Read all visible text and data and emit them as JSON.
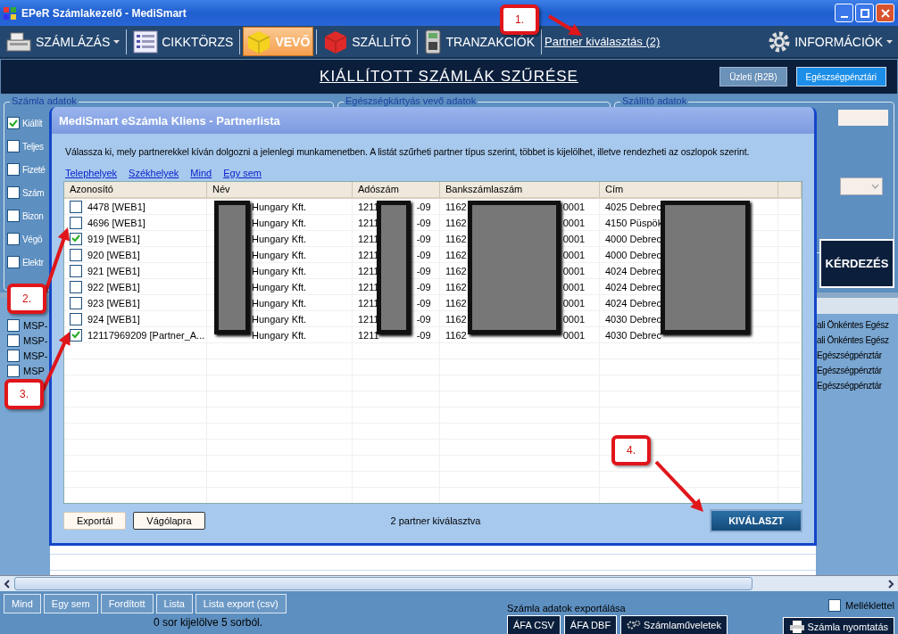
{
  "window": {
    "title": "EPeR Számlakezelő - MediSmart"
  },
  "toolbar": {
    "items": [
      {
        "label": "SZÁMLÁZÁS",
        "kind": "register",
        "dropdown": true,
        "selected": false
      },
      {
        "label": "CIKKTÖRZS",
        "kind": "list",
        "dropdown": false,
        "selected": false
      },
      {
        "label": "VEVŐ",
        "kind": "cube",
        "color": "#f5d21e",
        "dropdown": false,
        "selected": true
      },
      {
        "label": "SZÁLLÍTÓ",
        "kind": "cube",
        "color": "#e02a2a",
        "dropdown": false,
        "selected": false
      },
      {
        "label": "TRANZAKCIÓK",
        "kind": "terminal",
        "dropdown": false,
        "selected": false
      }
    ],
    "partner_link": "Partner kiválasztás (2)",
    "info": {
      "label": "INFORMÁCIÓK",
      "dropdown": true
    }
  },
  "filter_header": {
    "title": "KIÁLLÍTOTT SZÁMLÁK SZŰRÉSE",
    "modes": [
      {
        "label": "Üzleti (B2B)",
        "selected": false
      },
      {
        "label": "Egészségpénztári",
        "selected": true
      }
    ]
  },
  "filters": {
    "groups": [
      "Számla adatok",
      "Egészségkártyás vevő adatok",
      "Szállító adatok"
    ],
    "invoice_options": [
      {
        "label": "Kiállít",
        "checked": true
      },
      {
        "label": "Teljes",
        "checked": false
      },
      {
        "label": "Fizeté",
        "checked": false
      },
      {
        "label": "Szám",
        "checked": false
      },
      {
        "label": "Bizon",
        "checked": false
      },
      {
        "label": "Végö",
        "checked": false
      },
      {
        "label": "Elektr",
        "checked": false
      }
    ],
    "query_button": "KÉRDEZÉS"
  },
  "results": {
    "left_rows": [
      {
        "label": "MSP-",
        "checked": false
      },
      {
        "label": "MSP-",
        "checked": false
      },
      {
        "label": "MSP-",
        "checked": false
      },
      {
        "label": "MSP",
        "checked": false
      }
    ],
    "right_cells": [
      "ali Önkéntes Egész",
      "ali Önkéntes Egész",
      "Egészségpénztár",
      "Egészségpénztár",
      "Egészségpénztár"
    ]
  },
  "bottom": {
    "selection_buttons": [
      "Mind",
      "Egy sem",
      "Fordított",
      "Lista",
      "Lista export (csv)"
    ],
    "status": "0 sor kijelölve 5 sorból.",
    "export_label": "Számla adatok exportálása",
    "export_buttons": [
      "ÁFA CSV",
      "ÁFA DBF",
      "Számlaműveletek"
    ],
    "attachment": {
      "label": "Melléklettel",
      "checked": false
    },
    "print_button": "Számla nyomtatás"
  },
  "dialog": {
    "title": "MediSmart eSzámla Kliens - Partnerlista",
    "description": "Válassza ki, mely partnerekkel kíván dolgozni a jelenlegi munkamenetben. A listát szűrheti partner típus szerint, többet is kijelölhet, illetve rendezheti az oszlopok szerint.",
    "filter_links": [
      "Telephelyek",
      "Székhelyek",
      "Mind",
      "Egy sem"
    ],
    "columns": [
      "Azonosító",
      "Név",
      "Adószám",
      "Bankszámlaszám",
      "Cím"
    ],
    "rows": [
      {
        "id": "4478 [WEB1]",
        "checked": false,
        "name": "Hungary Kft.",
        "tax_start": "1211",
        "tax_end": "-09",
        "bank_start": "1162",
        "bank_end": "0001",
        "address": "4025 Debrec"
      },
      {
        "id": "4696 [WEB1]",
        "checked": false,
        "name": "Hungary Kft.",
        "tax_start": "1211",
        "tax_end": "-09",
        "bank_start": "1162",
        "bank_end": "0001",
        "address": "4150 Püspök"
      },
      {
        "id": "919 [WEB1]",
        "checked": true,
        "name": "Hungary Kft.",
        "tax_start": "1211",
        "tax_end": "-09",
        "bank_start": "1162",
        "bank_end": "0001",
        "address": "4000 Debrec"
      },
      {
        "id": "920 [WEB1]",
        "checked": false,
        "name": "Hungary Kft.",
        "tax_start": "1211",
        "tax_end": "-09",
        "bank_start": "1162",
        "bank_end": "0001",
        "address": "4000 Debrec"
      },
      {
        "id": "921 [WEB1]",
        "checked": false,
        "name": "Hungary Kft.",
        "tax_start": "1211",
        "tax_end": "-09",
        "bank_start": "1162",
        "bank_end": "0001",
        "address": "4024 Debrec"
      },
      {
        "id": "922 [WEB1]",
        "checked": false,
        "name": "Hungary Kft.",
        "tax_start": "1211",
        "tax_end": "-09",
        "bank_start": "1162",
        "bank_end": "0001",
        "address": "4024 Debrec"
      },
      {
        "id": "923 [WEB1]",
        "checked": false,
        "name": "Hungary Kft.",
        "tax_start": "1211",
        "tax_end": "-09",
        "bank_start": "1162",
        "bank_end": "0001",
        "address": "4024 Debrec"
      },
      {
        "id": "924 [WEB1]",
        "checked": false,
        "name": "Hungary Kft.",
        "tax_start": "1211",
        "tax_end": "-09",
        "bank_start": "1162",
        "bank_end": "0001",
        "address": "4030 Debrec"
      },
      {
        "id": "12117969209 [Partner_A...",
        "checked": true,
        "name": "Hungary Kft.",
        "tax_start": "1211",
        "tax_end": "-09",
        "bank_start": "1162",
        "bank_end": "0001",
        "address": "4030 Debrec"
      }
    ],
    "footer_buttons": [
      "Exportál",
      "Vágólapra"
    ],
    "status": "2 partner kiválasztva",
    "confirm_button": "KIVÁLASZT"
  },
  "callouts": [
    "1.",
    "2.",
    "3.",
    "4."
  ]
}
